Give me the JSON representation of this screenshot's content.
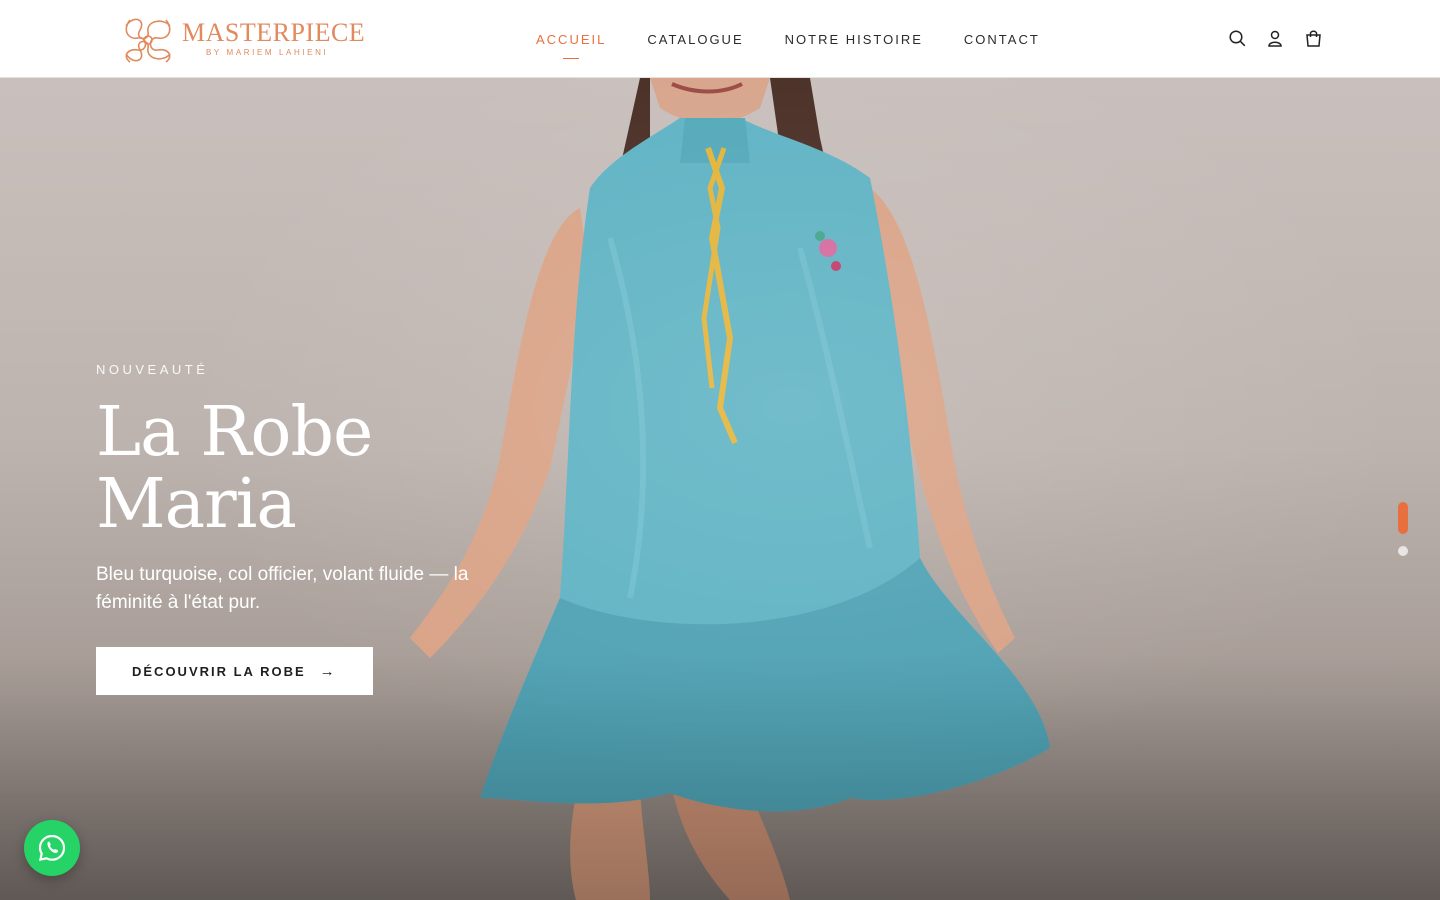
{
  "brand": {
    "name": "MASTERPIECE",
    "tagline": "BY MARIEM LAHIENI",
    "color": "#e08a5e"
  },
  "nav": {
    "items": [
      {
        "label": "ACCUEIL",
        "active": true
      },
      {
        "label": "CATALOGUE",
        "active": false
      },
      {
        "label": "NOTRE HISTOIRE",
        "active": false
      },
      {
        "label": "CONTACT",
        "active": false
      }
    ],
    "accent": "#e8703f"
  },
  "header_icons": [
    "search-icon",
    "account-icon",
    "cart-icon"
  ],
  "hero": {
    "eyebrow": "NOUVEAUTÉ",
    "title_line1": "La Robe",
    "title_line2": "Maria",
    "description": "Bleu turquoise, col officier, volant fluide — la féminité à l'état pur.",
    "cta_label": "DÉCOUVRIR LA ROBE",
    "cta_arrow": "→",
    "dress_color": "#5fb3c4",
    "slides_total": 2,
    "active_slide": 1
  },
  "floating": {
    "whatsapp_icon": "whatsapp-icon",
    "whatsapp_color": "#25d366"
  }
}
